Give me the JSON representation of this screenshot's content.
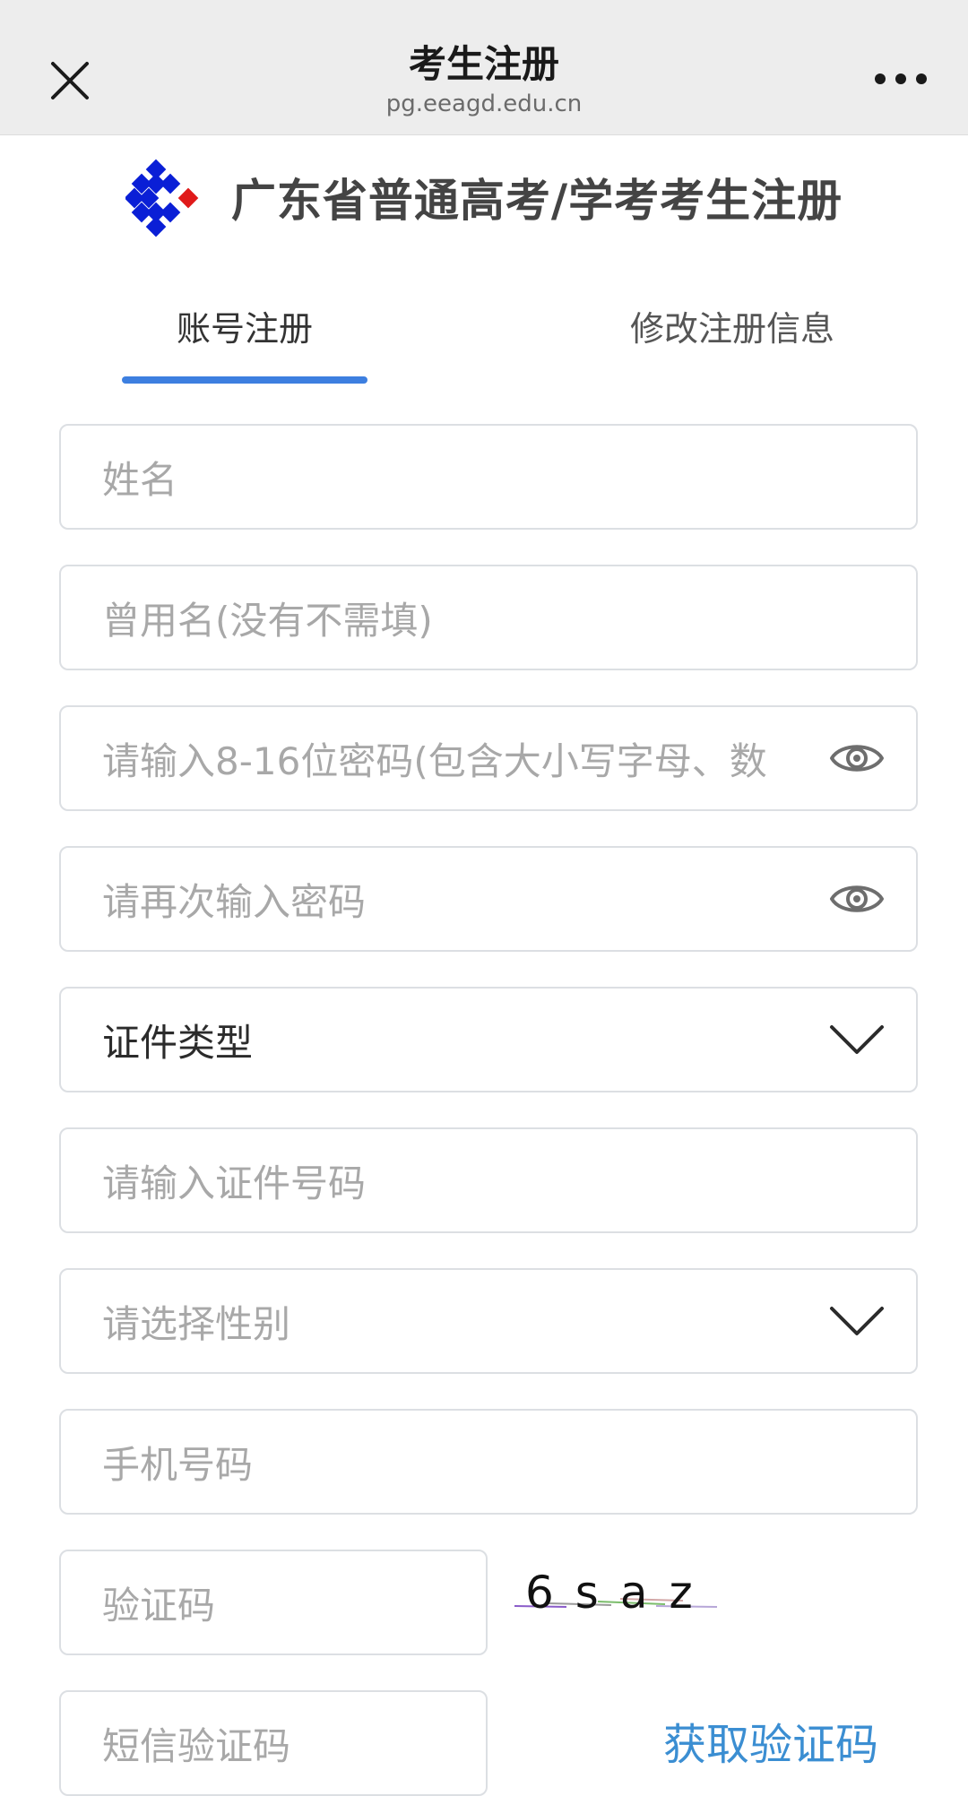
{
  "topbar": {
    "title": "考生注册",
    "url": "pg.eeagd.edu.cn"
  },
  "brand": {
    "title": "广东省普通高考/学考考生注册"
  },
  "tabs": [
    {
      "label": "账号注册",
      "active": true
    },
    {
      "label": "修改注册信息",
      "active": false
    }
  ],
  "form": {
    "name": {
      "placeholder": "姓名",
      "value": ""
    },
    "former_name": {
      "placeholder": "曾用名(没有不需填)",
      "value": ""
    },
    "password": {
      "placeholder": "请输入8-16位密码(包含大小写字母、数",
      "value": ""
    },
    "password_confirm": {
      "placeholder": "请再次输入密码",
      "value": ""
    },
    "id_type": {
      "selected": "证件类型"
    },
    "id_number": {
      "placeholder": "请输入证件号码",
      "value": ""
    },
    "gender": {
      "selected": "请选择性别"
    },
    "phone": {
      "placeholder": "手机号码",
      "value": ""
    },
    "captcha": {
      "placeholder": "验证码",
      "value": "",
      "image_text": "6saz"
    },
    "sms_code": {
      "placeholder": "短信验证码",
      "value": ""
    },
    "sms_button_label": "获取验证码"
  },
  "colors": {
    "accent": "#3d7fe0",
    "link": "#3b8ed2",
    "logo_blue": "#0a1fd6",
    "logo_red": "#e01a1a",
    "placeholder": "#a8a8a8",
    "border": "#dcdfe3"
  },
  "icons": {
    "close": "close-icon",
    "more": "more-icon",
    "eye": "eye-icon",
    "chevron": "chevron-down-icon"
  }
}
